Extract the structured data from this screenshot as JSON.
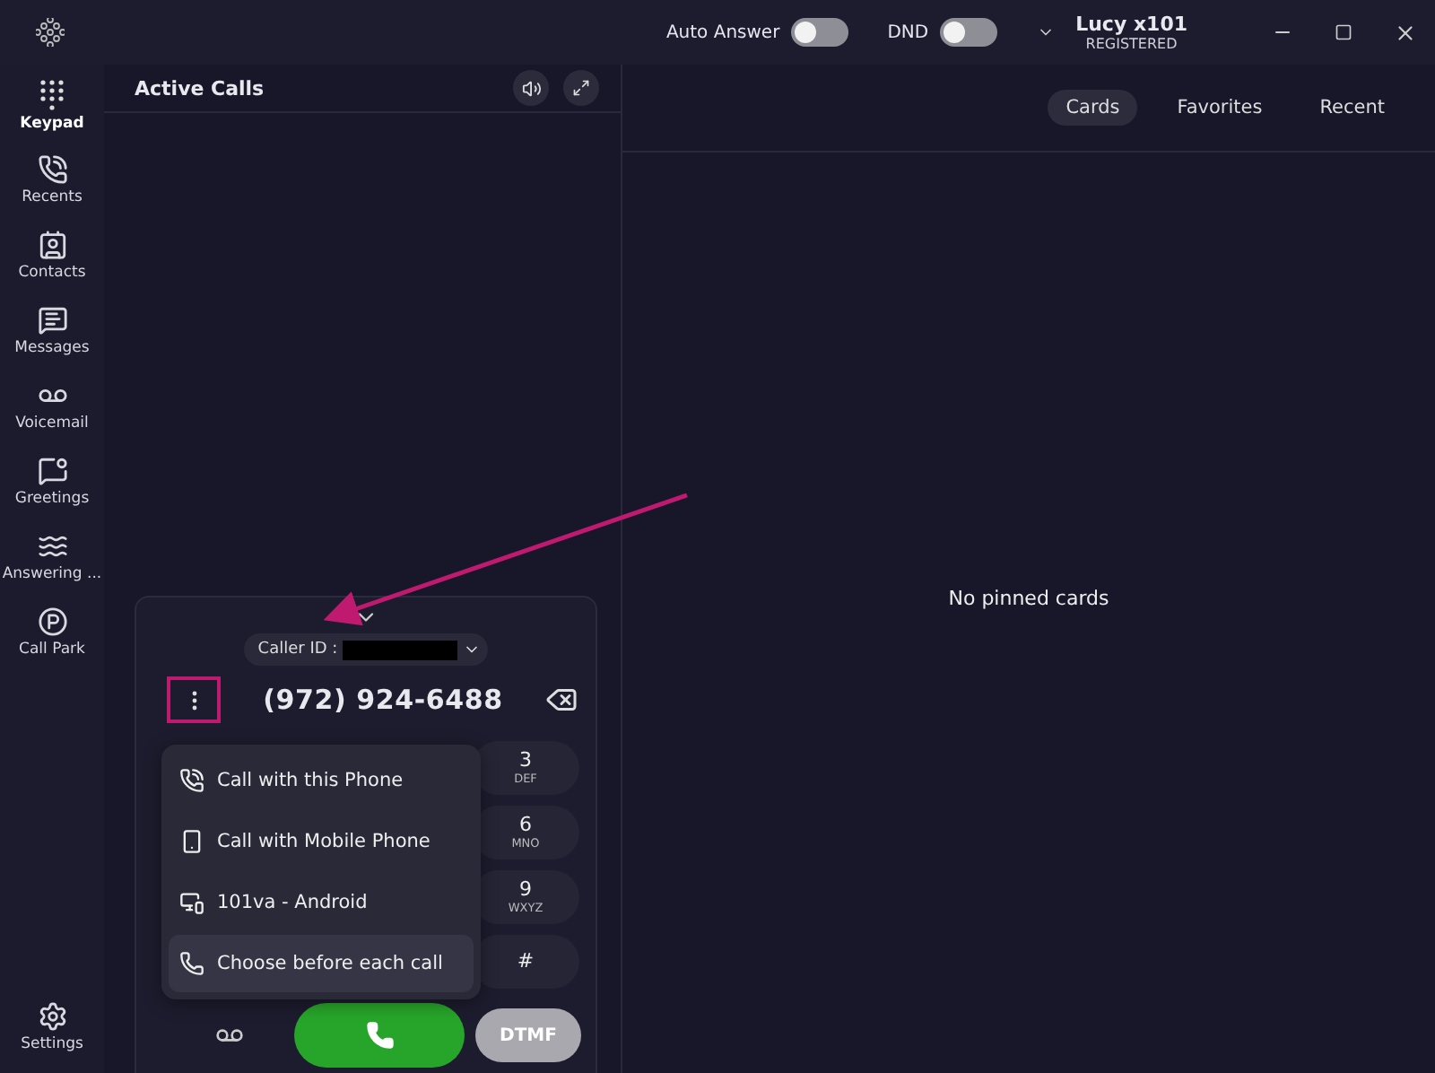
{
  "title_bar": {
    "auto_answer": {
      "label": "Auto Answer",
      "on": false
    },
    "dnd": {
      "label": "DND",
      "on": false
    },
    "user": {
      "name": "Lucy x101",
      "status": "REGISTERED"
    }
  },
  "sidebar": {
    "items": [
      {
        "label": "Keypad",
        "kind": "keypad",
        "selected": true
      },
      {
        "label": "Recents",
        "kind": "recents",
        "selected": false
      },
      {
        "label": "Contacts",
        "kind": "contacts",
        "selected": false
      },
      {
        "label": "Messages",
        "kind": "messages",
        "selected": false
      },
      {
        "label": "Voicemail",
        "kind": "voicemail",
        "selected": false
      },
      {
        "label": "Greetings",
        "kind": "greetings",
        "selected": false
      },
      {
        "label": "Answering ...",
        "kind": "answering",
        "selected": false
      },
      {
        "label": "Call Park",
        "kind": "park",
        "selected": false
      }
    ],
    "settings": {
      "label": "Settings"
    }
  },
  "active_calls": {
    "title": "Active Calls"
  },
  "dialer": {
    "caller_id_label": "Caller ID :",
    "number": "(972) 924-6488",
    "more_highlighted": true,
    "keys": [
      {
        "digit": "3",
        "letters": "DEF"
      },
      {
        "digit": "6",
        "letters": "MNO"
      },
      {
        "digit": "9",
        "letters": "WXYZ"
      },
      {
        "digit": "#"
      }
    ],
    "dtmf": {
      "label": "DTMF",
      "disabled": true
    },
    "menu": [
      {
        "label": "Call with this Phone",
        "kind": "sip",
        "selected": false
      },
      {
        "label": "Call with Mobile Phone",
        "kind": "mobile",
        "selected": false
      },
      {
        "label": "101va - Android",
        "kind": "devices",
        "selected": false
      },
      {
        "label": "Choose before each call",
        "kind": "phone",
        "selected": true
      }
    ]
  },
  "cards_panel": {
    "tabs": [
      {
        "label": "Cards",
        "selected": true
      },
      {
        "label": "Favorites",
        "selected": false
      },
      {
        "label": "Recent",
        "selected": false
      }
    ],
    "empty_message": "No pinned cards"
  }
}
